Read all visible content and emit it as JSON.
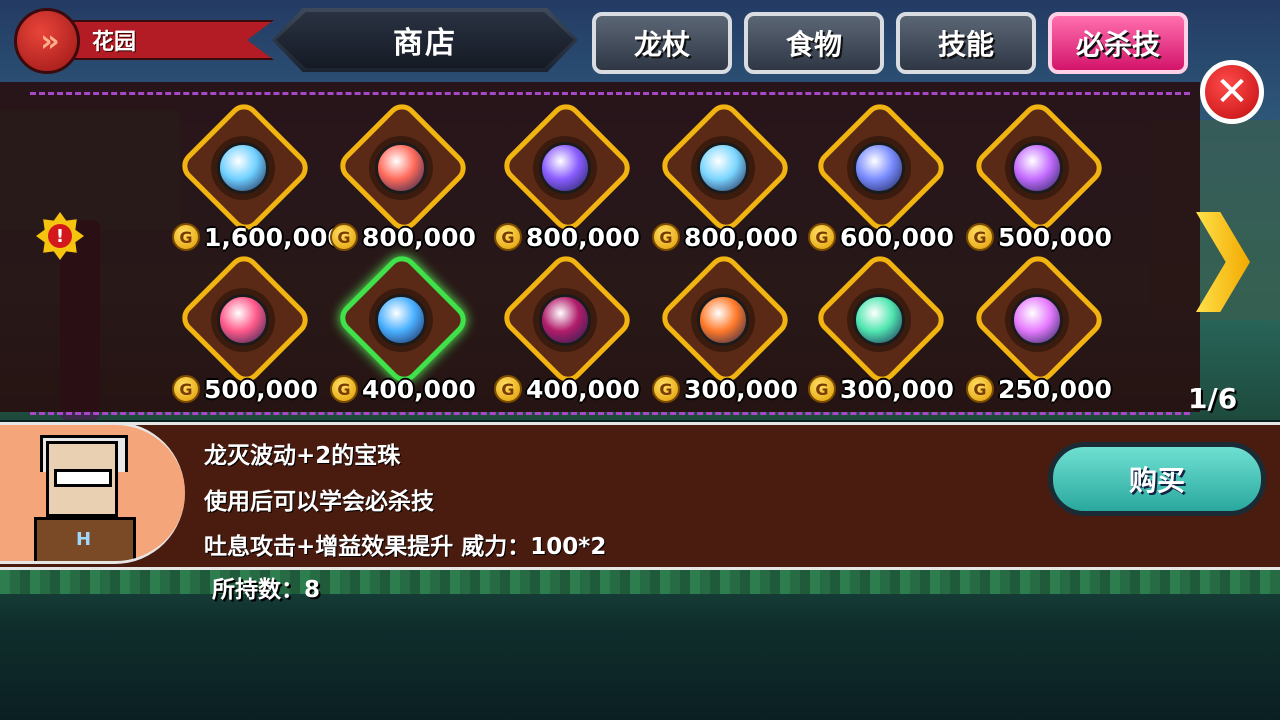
{
  "location": {
    "label": "花园"
  },
  "shop_title": "商店",
  "tabs": [
    {
      "label": "龙杖",
      "active": false
    },
    {
      "label": "食物",
      "active": false
    },
    {
      "label": "技能",
      "active": false
    },
    {
      "label": "必杀技",
      "active": true
    }
  ],
  "items": [
    {
      "price": "1,600,000",
      "orb_color": "#6fd0ff",
      "icon": "lightning-orb-icon"
    },
    {
      "price": "800,000",
      "orb_color": "#ff6a5a",
      "icon": "wolf-orb-icon"
    },
    {
      "price": "800,000",
      "orb_color": "#8a5cff",
      "icon": "swirl-orb-icon"
    },
    {
      "price": "800,000",
      "orb_color": "#7bd6ff",
      "icon": "spiral-orb-icon"
    },
    {
      "price": "600,000",
      "orb_color": "#7a8cff",
      "icon": "vortex-orb-icon"
    },
    {
      "price": "500,000",
      "orb_color": "#c46cff",
      "icon": "z-orb-icon"
    },
    {
      "price": "500,000",
      "orb_color": "#ff5a8a",
      "icon": "rock-orb-icon"
    },
    {
      "price": "400,000",
      "orb_color": "#4ab0ff",
      "icon": "breath-orb-icon",
      "selected": true
    },
    {
      "price": "400,000",
      "orb_color": "#b11c6a",
      "icon": "claw-orb-icon"
    },
    {
      "price": "300,000",
      "orb_color": "#ff7a2a",
      "icon": "fire-orb-icon"
    },
    {
      "price": "300,000",
      "orb_color": "#50e6b0",
      "icon": "fang-orb-icon"
    },
    {
      "price": "250,000",
      "orb_color": "#e67aff",
      "icon": "fang-pink-orb-icon"
    }
  ],
  "page_indicator": "1/6",
  "description": {
    "title": "龙灭波动+2的宝珠",
    "line2": "使用后可以学会必杀技",
    "line3": "吐息攻击+增益效果提升 威力：100*2"
  },
  "owned": "所持数：8",
  "buy_label": "购买",
  "colors": {
    "tab_active": "#d3146b",
    "frame": "#f2b411",
    "select": "#3fe24a"
  }
}
